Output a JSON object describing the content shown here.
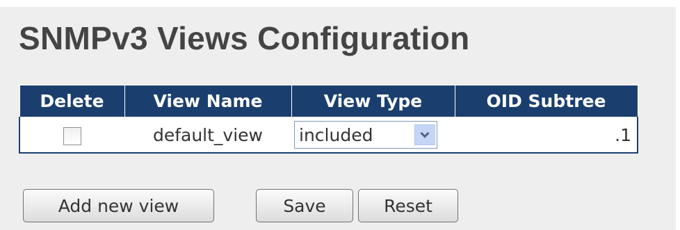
{
  "page": {
    "title": "SNMPv3 Views Configuration"
  },
  "table": {
    "headers": {
      "delete": "Delete",
      "view_name": "View Name",
      "view_type": "View Type",
      "oid_subtree": "OID Subtree"
    },
    "rows": [
      {
        "delete_checked": false,
        "view_name": "default_view",
        "view_type": "included",
        "oid_subtree": ".1"
      }
    ]
  },
  "buttons": {
    "add_new_view": "Add new view",
    "save": "Save",
    "reset": "Reset"
  },
  "icons": {
    "dropdown": "chevron-down-icon"
  },
  "colors": {
    "header_bg": "#1a3f6e",
    "panel_bg": "#eeeeee",
    "title": "#444444"
  }
}
